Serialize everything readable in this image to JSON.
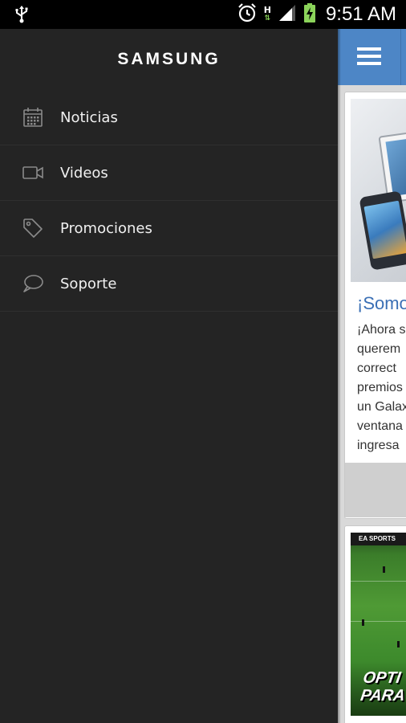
{
  "status_bar": {
    "time": "9:51 AM",
    "network_type": "H",
    "network_arrows": "⇅",
    "icons": [
      "usb-icon",
      "alarm-icon",
      "signal-icon",
      "battery-charging-icon"
    ]
  },
  "drawer": {
    "brand": "SAMSUNG",
    "items": [
      {
        "label": "Noticias",
        "icon": "calendar-icon"
      },
      {
        "label": "Videos",
        "icon": "video-camera-icon"
      },
      {
        "label": "Promociones",
        "icon": "tag-icon"
      },
      {
        "label": "Soporte",
        "icon": "speech-bubble-icon"
      }
    ]
  },
  "main": {
    "action_bar_color": "#4d86c6",
    "menu_icon": "hamburger-menu-icon",
    "feed": [
      {
        "headline": "¡Somo",
        "body_lines": [
          "¡Ahora s",
          "querem",
          "correct",
          "premios",
          "un Galax",
          "ventana",
          "ingresa"
        ]
      },
      {
        "banner_brand": "EA SPORTS",
        "promo_lines": [
          "OPTI",
          "PARA"
        ]
      }
    ]
  },
  "colors": {
    "drawer_bg": "#242424",
    "accent_blue": "#4d86c6",
    "headline_blue": "#3a6fb5"
  }
}
